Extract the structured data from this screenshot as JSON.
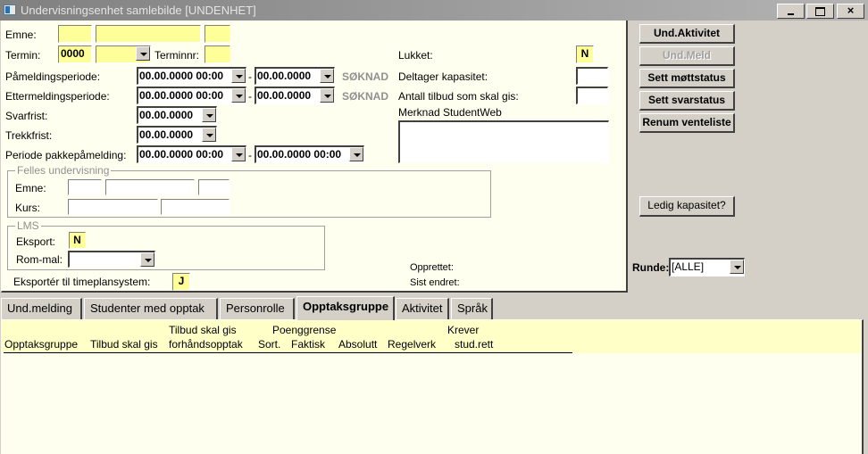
{
  "window": {
    "title": "Undervisningsenhet samlebilde [UNDENHET]",
    "controls": {
      "minimize": "minimize",
      "maximize": "maximize",
      "close": "×"
    }
  },
  "form": {
    "emne_label": "Emne:",
    "emne": {
      "code": "",
      "name": "",
      "version": ""
    },
    "termin_label": "Termin:",
    "termin_year": "0000",
    "termin_season": "",
    "terminnr_label": "Terminnr:",
    "terminnr": "",
    "pamelding_label": "Påmeldingsperiode:",
    "pamelding_from": "00.00.0000 00:00",
    "pamelding_to": "00.00.0000",
    "ettermelding_label": "Ettermeldingsperiode:",
    "ettermelding_from": "00.00.0000 00:00",
    "ettermelding_to": "00.00.0000",
    "soknad_label": "SØKNAD",
    "svarfrist_label": "Svarfrist:",
    "svarfrist": "00.00.0000",
    "trekkfrist_label": "Trekkfrist:",
    "trekkfrist": "00.00.0000",
    "pakke_label": "Periode pakkepåmelding:",
    "pakke_from": "00.00.0000 00:00",
    "pakke_to": "00.00.0000 00:00",
    "dash": "-",
    "lukket_label": "Lukket:",
    "lukket": "N",
    "kapasitet_label": "Deltager kapasitet:",
    "kapasitet": "",
    "antall_label": "Antall tilbud som skal gis:",
    "antall": "",
    "merknad_label": "Merknad StudentWeb",
    "merknad": "",
    "felles": {
      "legend": "Felles undervisning",
      "emne_label": "Emne:",
      "kurs_label": "Kurs:"
    },
    "lms": {
      "legend": "LMS",
      "eksport_label": "Eksport:",
      "eksport": "N",
      "rommal_label": "Rom-mal:",
      "rommal": ""
    },
    "timeplan_label": "Eksportér til timeplansystem:",
    "timeplan": "J",
    "opprettet_label": "Opprettet:",
    "sist_endret_label": "Sist endret:"
  },
  "side": {
    "buttons": [
      "Und.Aktivitet",
      "Und.Meld",
      "Sett møttstatus",
      "Sett svarstatus",
      "Renum venteliste"
    ],
    "ledig": "Ledig kapasitet?",
    "runde_label": "Runde:",
    "runde": "[ALLE]"
  },
  "tabs": [
    "Und.melding",
    "Studenter med opptak",
    "Personrolle",
    "Opptaksgruppe",
    "Aktivitet",
    "Språk"
  ],
  "active_tab": "Opptaksgruppe",
  "table": {
    "group_headers": {
      "tilbud": "Tilbud skal gis",
      "poenggrense": "Poenggrense",
      "krever": "Krever"
    },
    "columns": [
      "Opptaksgruppe",
      "Tilbud skal gis",
      "forhåndsopptak",
      "Sort.",
      "Faktisk",
      "Absolutt",
      "Regelverk",
      "stud.rett"
    ],
    "rows": []
  }
}
